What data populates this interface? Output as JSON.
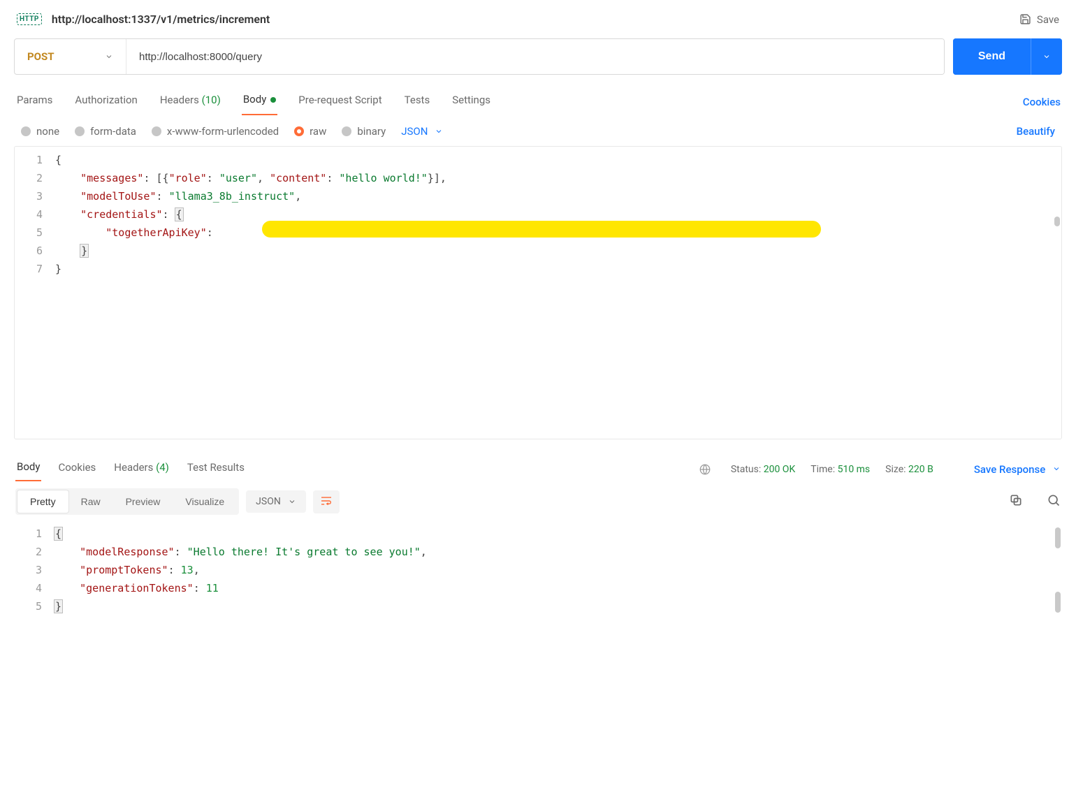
{
  "header": {
    "title": "http://localhost:1337/v1/metrics/increment",
    "save_label": "Save"
  },
  "request": {
    "method": "POST",
    "url": "http://localhost:8000/query",
    "send_label": "Send"
  },
  "reqTabs": {
    "params": "Params",
    "auth": "Authorization",
    "headers_label": "Headers",
    "headers_count": "(10)",
    "body": "Body",
    "prereq": "Pre-request Script",
    "tests": "Tests",
    "settings": "Settings",
    "cookies": "Cookies"
  },
  "bodyType": {
    "none": "none",
    "form": "form-data",
    "urlenc": "x-www-form-urlencoded",
    "raw": "raw",
    "binary": "binary",
    "json": "JSON",
    "beautify": "Beautify"
  },
  "reqBody": {
    "l1": "{",
    "l2_key_messages": "\"messages\"",
    "l2_role_k": "\"role\"",
    "l2_role_v": "\"user\"",
    "l2_content_k": "\"content\"",
    "l2_content_v": "\"hello world!\"",
    "l3_k": "\"modelToUse\"",
    "l3_v": "\"llama3_8b_instruct\"",
    "l4_k": "\"credentials\"",
    "l5_k": "\"togetherApiKey\"",
    "l7": "}"
  },
  "respTabs": {
    "body": "Body",
    "cookies": "Cookies",
    "headers_label": "Headers",
    "headers_count": "(4)",
    "tests": "Test Results",
    "status_label": "Status:",
    "status_value": "200 OK",
    "time_label": "Time:",
    "time_value": "510 ms",
    "size_label": "Size:",
    "size_value": "220 B",
    "save_response": "Save Response"
  },
  "respViews": {
    "pretty": "Pretty",
    "raw": "Raw",
    "preview": "Preview",
    "visualize": "Visualize",
    "json": "JSON"
  },
  "respBody": {
    "k1": "\"modelResponse\"",
    "v1": "\"Hello there! It's great to see you!\"",
    "k2": "\"promptTokens\"",
    "v2": "13",
    "k3": "\"generationTokens\"",
    "v3": "11"
  }
}
